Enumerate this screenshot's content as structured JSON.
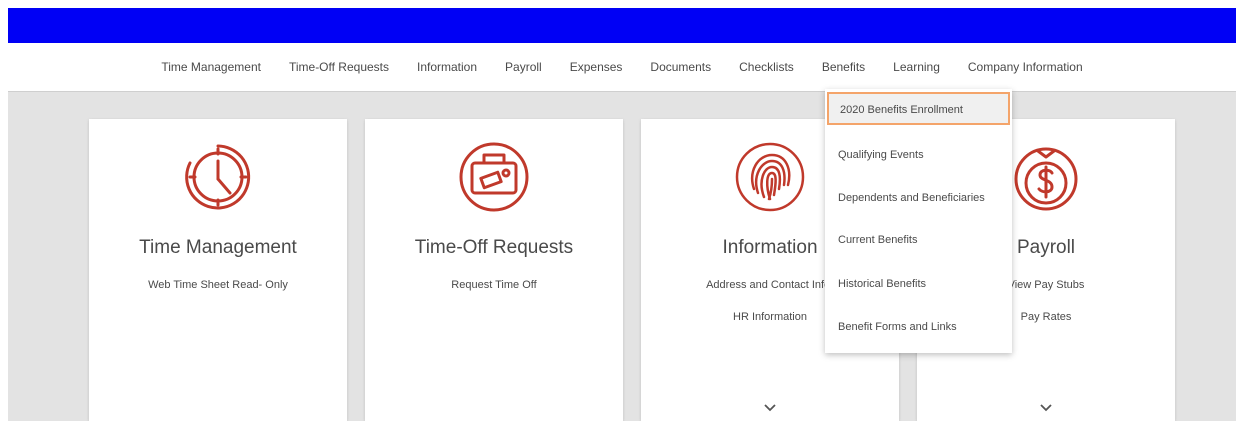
{
  "nav": {
    "items": [
      "Time Management",
      "Time-Off Requests",
      "Information",
      "Payroll",
      "Expenses",
      "Documents",
      "Checklists",
      "Benefits",
      "Learning",
      "Company Information"
    ]
  },
  "cards": [
    {
      "title": "Time Management",
      "links": [
        "Web Time Sheet Read- Only"
      ],
      "icon": "clock-icon"
    },
    {
      "title": "Time-Off Requests",
      "links": [
        "Request Time Off"
      ],
      "icon": "suitcase-icon"
    },
    {
      "title": "Information",
      "links": [
        "Address and Contact Infor",
        "HR Information"
      ],
      "icon": "fingerprint-icon"
    },
    {
      "title": "Payroll",
      "links": [
        "View Pay Stubs",
        "Pay Rates"
      ],
      "icon": "money-bag-icon"
    }
  ],
  "benefits_menu": {
    "items": [
      "2020 Benefits Enrollment",
      "Qualifying Events",
      "Dependents and Beneficiaries",
      "Current Benefits",
      "Historical Benefits",
      "Benefit Forms and Links"
    ],
    "highlighted": "2020 Benefits Enrollment"
  },
  "colors": {
    "topbar": "#0000f5",
    "icon": "#c0392b",
    "highlight_border": "#f4a46a",
    "content_bg": "#e3e3e3"
  }
}
